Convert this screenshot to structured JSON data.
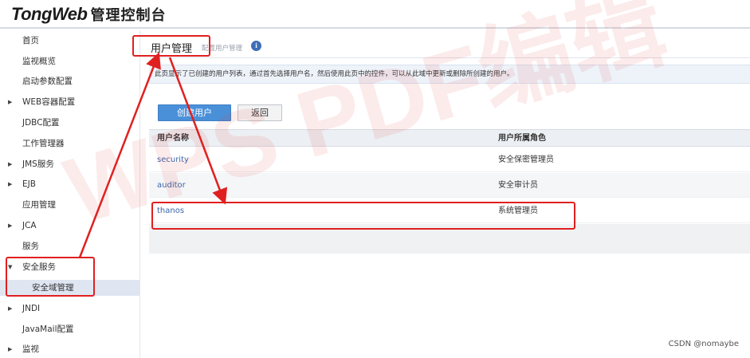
{
  "header": {
    "logo_brand": "TongWeb",
    "logo_title": "管理控制台"
  },
  "sidebar": {
    "items": [
      {
        "label": "首页",
        "expandable": false
      },
      {
        "label": "监视概览",
        "expandable": false
      },
      {
        "label": "启动参数配置",
        "expandable": false
      },
      {
        "label": "WEB容器配置",
        "expandable": true,
        "arrow": "▶"
      },
      {
        "label": "JDBC配置",
        "expandable": false
      },
      {
        "label": "工作管理器",
        "expandable": false
      },
      {
        "label": "JMS服务",
        "expandable": true,
        "arrow": "▶"
      },
      {
        "label": "EJB",
        "expandable": true,
        "arrow": "▶"
      },
      {
        "label": "应用管理",
        "expandable": false
      },
      {
        "label": "JCA",
        "expandable": true,
        "arrow": "▶"
      },
      {
        "label": "服务",
        "expandable": false
      },
      {
        "label": "安全服务",
        "expandable": true,
        "arrow": "▼",
        "expanded": true
      },
      {
        "label": "安全域管理",
        "expandable": false,
        "sub": true,
        "active": true
      },
      {
        "label": "JNDI",
        "expandable": true,
        "arrow": "▶"
      },
      {
        "label": "JavaMail配置",
        "expandable": false
      },
      {
        "label": "监视",
        "expandable": true,
        "arrow": "▶"
      }
    ]
  },
  "main": {
    "title": "用户管理",
    "breadcrumb": "配置用户管理",
    "info_icon": "i",
    "description": "此页显示了已创建的用户列表，通过首先选择用户名，然后使用此页中的控件，可以从此域中更新或删除所创建的用户。",
    "buttons": {
      "create": "创建用户",
      "back": "返回"
    },
    "table": {
      "columns": [
        "用户名称",
        "用户所属角色"
      ],
      "rows": [
        {
          "name": "security",
          "role": "安全保密管理员"
        },
        {
          "name": "auditor",
          "role": "安全审计员"
        },
        {
          "name": "thanos",
          "role": "系统管理员"
        }
      ]
    }
  },
  "watermark": "WPS PDF编辑",
  "credit": "CSDN @nomaybe",
  "colors": {
    "accent": "#4a90d9",
    "annotation": "#e02020",
    "link": "#3a66a8"
  }
}
